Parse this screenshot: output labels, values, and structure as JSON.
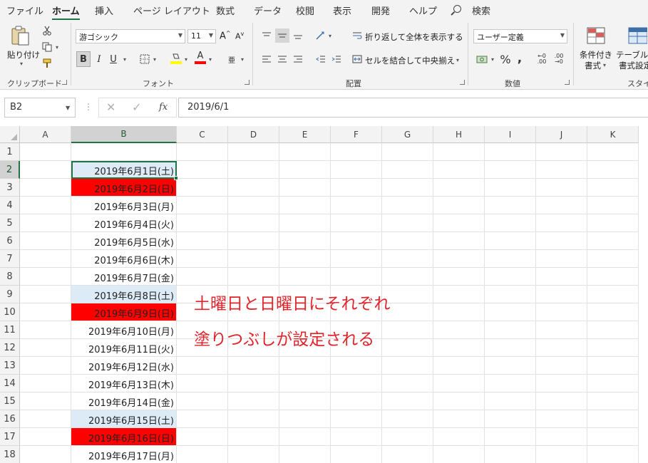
{
  "menu": {
    "tabs": [
      "ファイル",
      "ホーム",
      "挿入",
      "ページ レイアウト",
      "数式",
      "データ",
      "校閲",
      "表示",
      "開発",
      "ヘルプ"
    ],
    "active": "ホーム",
    "search_label": "検索"
  },
  "ribbon": {
    "clipboard": {
      "paste_label": "貼り付け",
      "group_label": "クリップボード"
    },
    "font": {
      "font_name": "游ゴシック",
      "font_size": "11",
      "group_label": "フォント"
    },
    "alignment": {
      "wrap_label": "折り返して全体を表示する",
      "merge_label": "セルを結合して中央揃え",
      "group_label": "配置"
    },
    "number": {
      "format": "ユーザー定義",
      "group_label": "数値"
    },
    "styles": {
      "conditional_label_1": "条件付き",
      "conditional_label_2": "書式",
      "table_label_1": "テーブルと",
      "table_label_2": "書式設定",
      "group_label": "スタイル"
    }
  },
  "formula_bar": {
    "name_box": "B2",
    "formula": "2019/6/1",
    "fx_label": "fx"
  },
  "grid": {
    "columns": [
      "A",
      "B",
      "C",
      "D",
      "E",
      "F",
      "G",
      "H",
      "I",
      "J",
      "K"
    ],
    "selected_column": "B",
    "selected_row": 2,
    "rows": [
      {
        "num": "1",
        "b": "",
        "type": ""
      },
      {
        "num": "2",
        "b": "2019年6月1日(土)",
        "type": "sat"
      },
      {
        "num": "3",
        "b": "2019年6月2日(日)",
        "type": "sun"
      },
      {
        "num": "4",
        "b": "2019年6月3日(月)",
        "type": ""
      },
      {
        "num": "5",
        "b": "2019年6月4日(火)",
        "type": ""
      },
      {
        "num": "6",
        "b": "2019年6月5日(水)",
        "type": ""
      },
      {
        "num": "7",
        "b": "2019年6月6日(木)",
        "type": ""
      },
      {
        "num": "8",
        "b": "2019年6月7日(金)",
        "type": ""
      },
      {
        "num": "9",
        "b": "2019年6月8日(土)",
        "type": "sat"
      },
      {
        "num": "10",
        "b": "2019年6月9日(日)",
        "type": "sun"
      },
      {
        "num": "11",
        "b": "2019年6月10日(月)",
        "type": ""
      },
      {
        "num": "12",
        "b": "2019年6月11日(火)",
        "type": ""
      },
      {
        "num": "13",
        "b": "2019年6月12日(水)",
        "type": ""
      },
      {
        "num": "14",
        "b": "2019年6月13日(木)",
        "type": ""
      },
      {
        "num": "15",
        "b": "2019年6月14日(金)",
        "type": ""
      },
      {
        "num": "16",
        "b": "2019年6月15日(土)",
        "type": "sat"
      },
      {
        "num": "17",
        "b": "2019年6月16日(日)",
        "type": "sun"
      },
      {
        "num": "18",
        "b": "2019年6月17日(月)",
        "type": ""
      }
    ]
  },
  "annotation": {
    "line1": "土曜日と日曜日にそれぞれ",
    "line2": "塗りつぶしが設定される"
  },
  "colors": {
    "saturday_fill": "#ddebf7",
    "sunday_fill": "#ff0000",
    "annotation_text": "#e0242b",
    "excel_green": "#217346"
  }
}
